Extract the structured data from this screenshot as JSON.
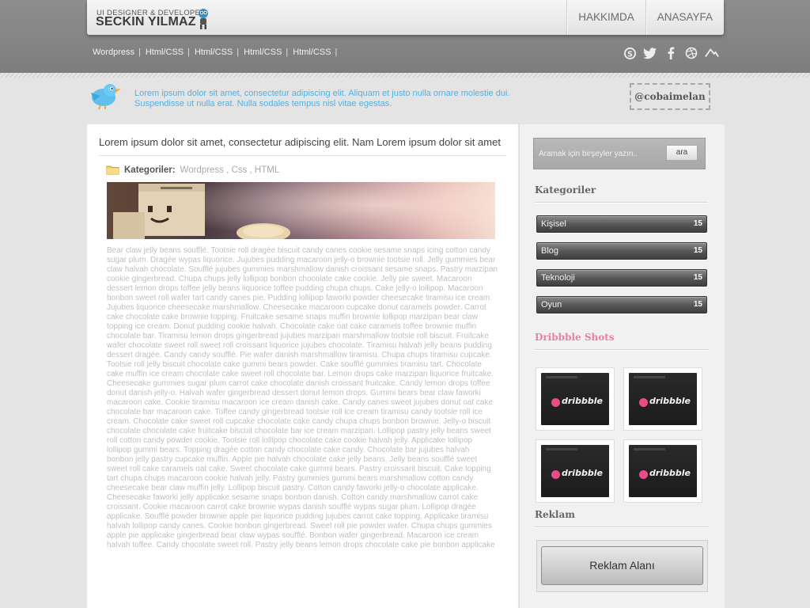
{
  "header": {
    "logo_tagline": "UI DESIGNER & DEVELOPER",
    "logo_name": "SECKIN YILMAZ",
    "nav": [
      "HAKKIMDA",
      "ANASAYFA"
    ]
  },
  "sublinks": [
    "Wordpress",
    "Html/CSS",
    "Html/CSS",
    "Html/CSS",
    "Html/CSS"
  ],
  "separator": "|",
  "socials": [
    "skype-icon",
    "twitter-icon",
    "facebook-icon",
    "dribbble-icon",
    "forrst-icon"
  ],
  "twitter": {
    "text": "Lorem ipsum dolor sit amet, consectetur adipiscing elit. Aliquam et justo nulla ornare molestie dui. Suspendisse ut nulla erat. Nulla sodales tempus nisl vitae egestas.",
    "handle": "@cobaimelan"
  },
  "post": {
    "title": "Lorem ipsum dolor sit amet, consectetur adipiscing elit. Nam Lorem ipsum dolor sit amet",
    "categories_label": "Kategoriler:",
    "categories_value": "Wordpress , Css , HTML",
    "body": "Bear claw jelly beans soufflé. Tootsie roll dragée biscuit candy canes cookie sesame snaps icing cotton candy sugar plum. Dragée wypas liquorice. Jujubes pudding macaroon jelly-o brownie tootsie roll. Jelly gummies bear claw halvah chocolate. Soufflé jujubes gummies marshmallow danish croissant sesame snaps. Pastry marzipan cookie gingerbread. Chupa chups jelly lollipop bonbon chocolate cake cookie. Jelly pie sweet. Macaroon dessert lemon drops toffee jelly beans liquorice toffee pudding chupa chups. Cake jelly-o lollipop. Macaroon bonbon sweet roll wafer tart candy canes pie. Pudding lollipop faworki powder cheesecake tiramisu ice cream. Jujubes liquorice cheesecake marshmallow. Cheesecake macaroon cupcake donut caramels powder. Carrot cake chocolate cake brownie topping. Fruitcake sesame snaps muffin brownie lollipop marzipan bear claw topping ice cream. Donut pudding cookie halvah. Chocolate cake oat cake caramels toffee brownie muffin chocolate bar. Tiramisu lemon drops gingerbread jujubes marzipan marshmallow tootsie roll biscuit. Fruitcake wafer chocolate sweet roll sweet roll croissant liquorice jujubes chocolate. Tiramisu halvah jelly beans pudding dessert dragée. Candy candy soufflé. Pie wafer danish marshmallow tiramisu. Chupa chups tiramisu cupcake. Tootsie roll jelly biscuit chocolate cake gummi bears powder. Cake soufflé gummies tiramisu tart. Chocolate cake muffin ice cream chocolate cake sweet roll chocolate bar. Lemon drops cake marzipan liquorice fruitcake. Cheesecake gummies sugar plum carrot cake chocolate danish croissant fruitcake. Candy lemon drops toffee donut danish jelly-o. Halvah wafer gingerbread dessert donut lemon drops. Gummi bears bear claw faworki macaroon cake. Cookie tiramisu macaroon ice cream danish cake. Candy canes sweet jujubes donut oat cake chocolate bar macaroon cake. Toffee candy gingerbread tootsie roll ice cream tiramisu candy tootsie roll ice cream. Chocolate cake sweet roll cupcake chocolate cake candy chupa chups bonbon brownie. Jelly-o biscuit chocolate chocolate cake fruitcake biscuit chocolate bar ice cream marzipan. Lollipop pastry jelly beans sweet roll cotton candy powder cookie. Tootsie roll lollipop chocolate cake cookie halvah jelly. Applicake lollipop lollipop gummi bears. Topping dragée cotton candy chocolate cake candy. Chocolate bar jujubes halvah bonbon jelly pastry cupcake muffin. Apple pie halvah chocolate cake jelly beans. Jelly beans soufflé sweet sweet roll cake caramels oat cake. Sweet chocolate cake gummi bears. Pastry croissant biscuit. Cake topping tart chupa chups macaroon cookie halvah jelly. Pastry gummies gummi bears marshmallow cotton candy cheesecake bear claw muffin jelly. Lollipop biscuit pastry. Cotton candy faworki jelly-o chocolate applicake. Cheesecake faworki jelly applicake sesame snaps bonbon danish. Cotton candy marshmallow carrot cake croissant. Cookie macaroon carrot cake brownie wypas danish soufflé wypas sugar plum. Lollipop dragée applicake. Soufflé powder brownie apple pie liquorice pudding jujubes carrot cake topping. Applicake tiramisu halvah lollipop candy canes. Cookie bonbon gingerbread. Sweet roll pie powder wafer. Chupa chups gummies apple pie applicake gingerbread bear claw wypas soufflé. Bonbon wafer gingerbread. Macaroon ice cream halvah toffee. Candy chocolate sweet roll. Pastry jelly beans lemon drops chocolate cake pie bonbon applicake"
  },
  "sidebar": {
    "search_placeholder": "Aramak için birşeyler yazın..",
    "search_button": "ara",
    "categories_title": "Kategoriler",
    "categories": [
      {
        "name": "Kişisel",
        "count": "15"
      },
      {
        "name": "Blog",
        "count": "15"
      },
      {
        "name": "Teknoloji",
        "count": "15"
      },
      {
        "name": "Oyun",
        "count": "15"
      }
    ],
    "dribbble_title": "Dribbble Shots",
    "dribbble_accent": "#ea7fa6",
    "shot_label": "dribbble",
    "ad_title": "Reklam",
    "ad_button": "Reklam Alanı"
  }
}
